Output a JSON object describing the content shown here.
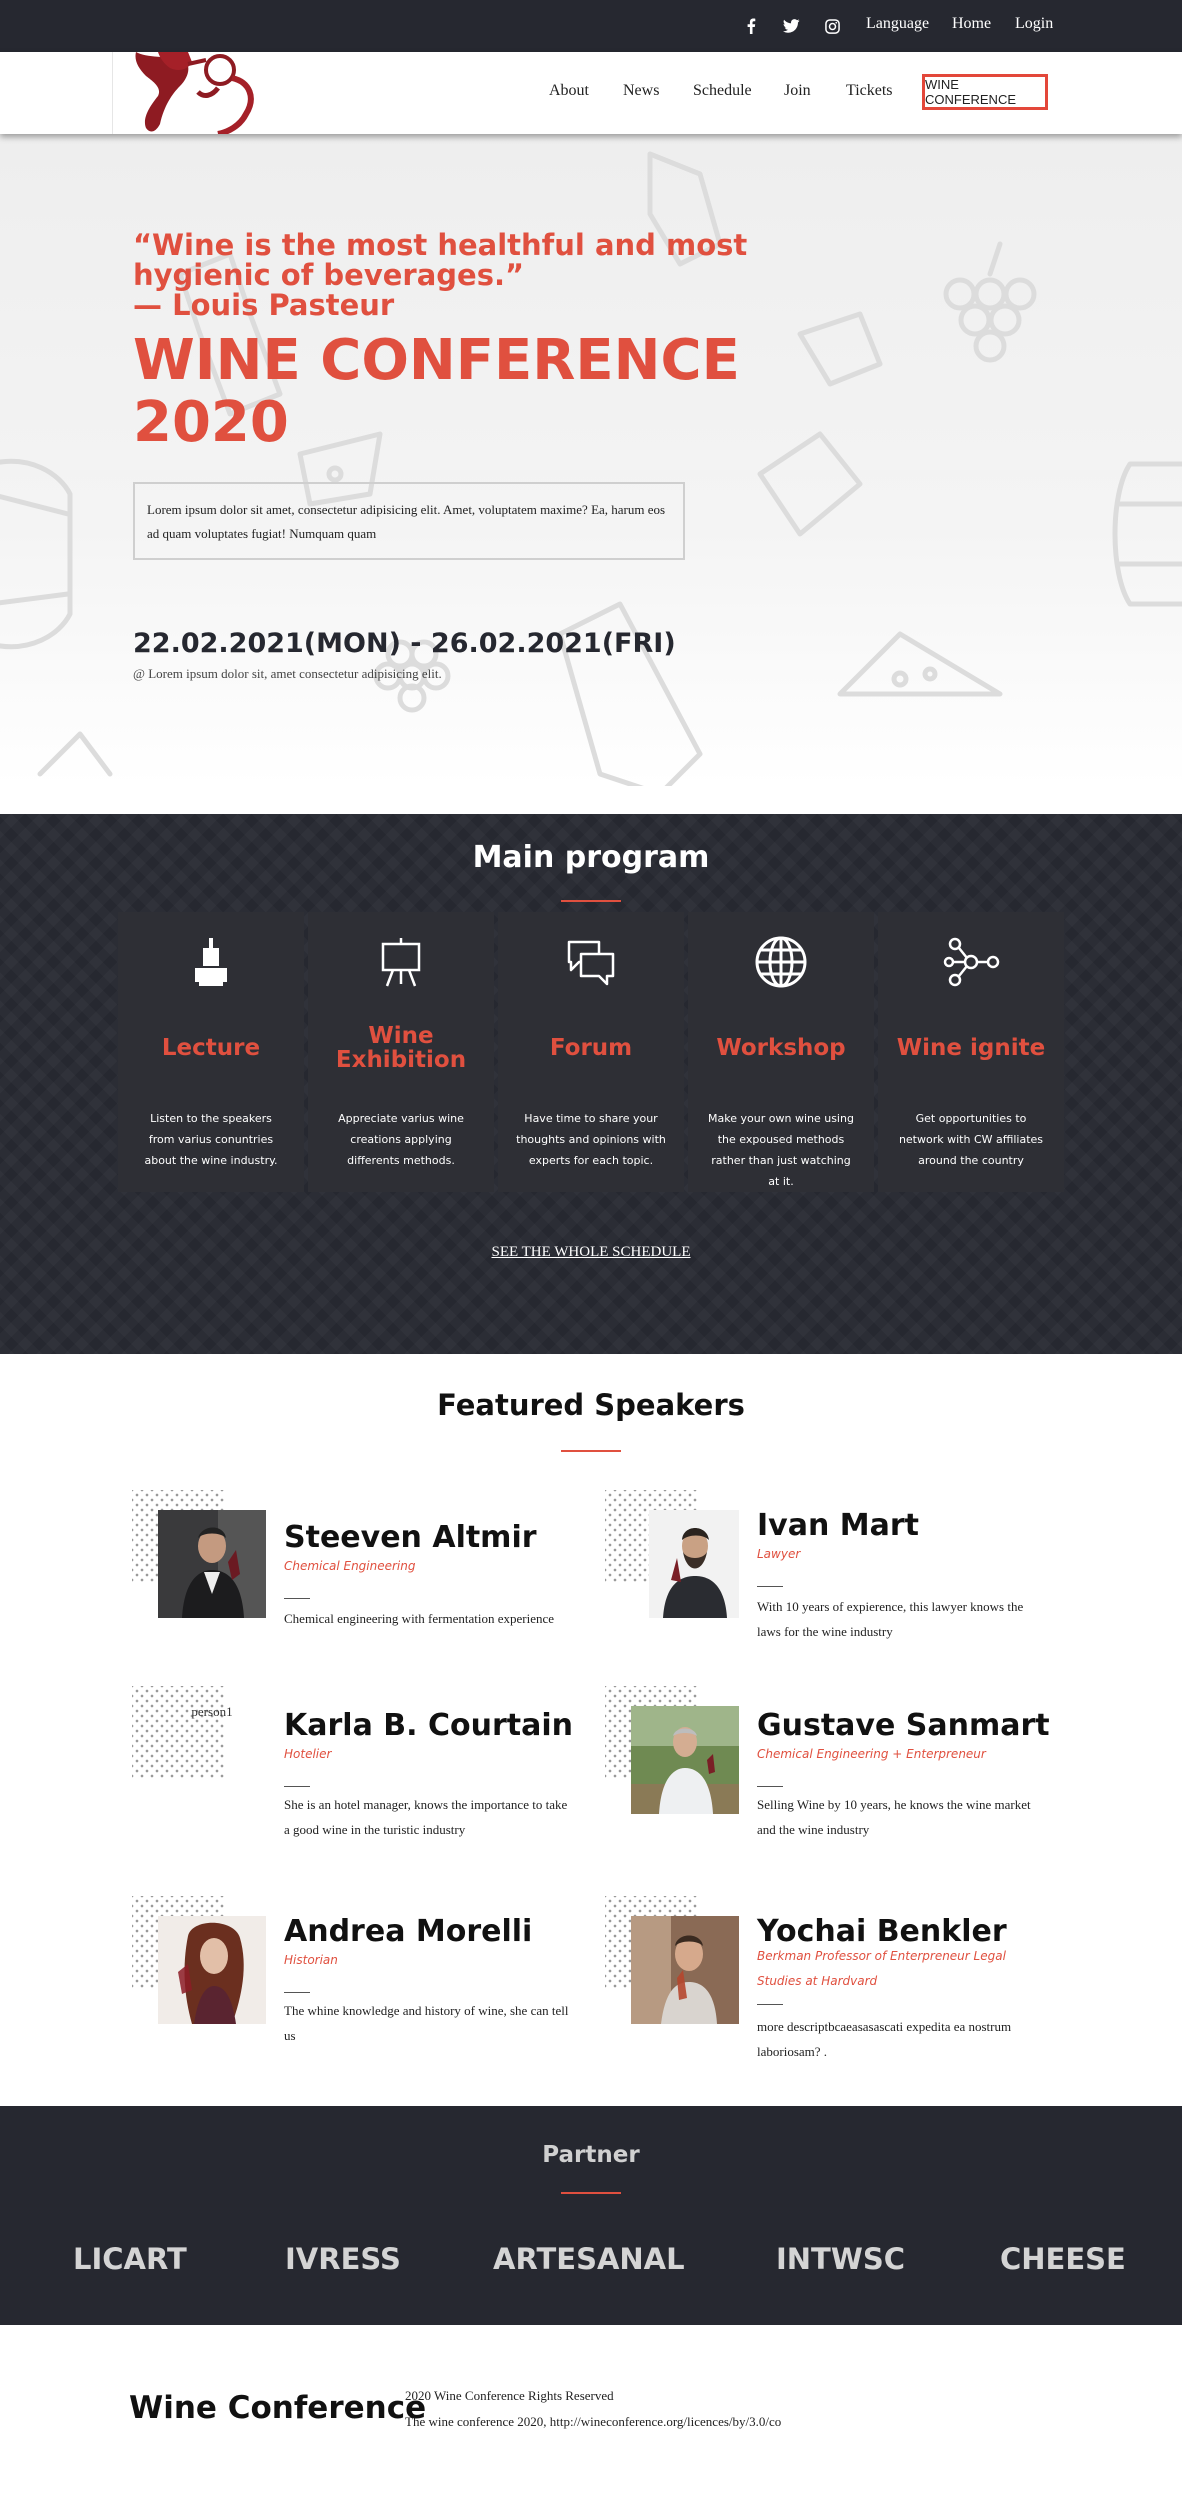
{
  "topbar": {
    "social": [
      "facebook-icon",
      "twitter-icon",
      "instagram-icon"
    ],
    "links": [
      "Language",
      "Home",
      "Login"
    ]
  },
  "nav": {
    "items": [
      "About",
      "News",
      "Schedule",
      "Join",
      "Tickets"
    ],
    "cta": "WINE CONFERENCE"
  },
  "hero": {
    "quote": "“Wine is the most healthful and most hygienic of beverages.”",
    "author": "— Louis Pasteur",
    "title": "WINE CONFERENCE 2020",
    "box_text": "Lorem ipsum dolor sit amet, consectetur adipisicing elit. Amet, voluptatem maxime? Ea, harum eos ad quam voluptates fugiat! Numquam quam",
    "date": "22.02.2021(MON) - 26.02.2021(FRI)",
    "location": "@ Lorem ipsum dolor sit, amet consectetur adipisicing elit."
  },
  "program": {
    "title": "Main program",
    "cards": [
      {
        "icon": "lectern-icon",
        "title": "Lecture",
        "desc": "Listen to the speakers from varius conuntries about the wine industry."
      },
      {
        "icon": "easel-board-icon",
        "title": "Wine Exhibition",
        "desc": "Appreciate varius wine creations applying differents methods."
      },
      {
        "icon": "chat-bubbles-icon",
        "title": "Forum",
        "desc": "Have time to share your thoughts and opinions with experts for each topic."
      },
      {
        "icon": "globe-icon",
        "title": "Workshop",
        "desc": "Make your own wine using the expoused methods rather than just watching at it."
      },
      {
        "icon": "network-icon",
        "title": "Wine ignite",
        "desc": "Get opportunities to network with CW affiliates around the country"
      }
    ],
    "schedule_link": "SEE THE WHOLE SCHEDULE"
  },
  "speakers": {
    "title": "Featured Speakers",
    "items": [
      {
        "name": "Steeven Altmir",
        "role": "Chemical Engineering",
        "desc": "Chemical engineering with fermentation experience"
      },
      {
        "name": "Ivan Mart",
        "role": "Lawyer",
        "desc": "With 10 years of expierence, this lawyer knows the laws for the wine industry"
      },
      {
        "name": "Karla B. Courtain",
        "role": "Hotelier",
        "desc": "She is an hotel manager, knows the importance to take a good wine in the turistic industry",
        "photo_alt": "person1"
      },
      {
        "name": "Gustave Sanmart",
        "role": "Chemical Engineering + Enterpreneur",
        "desc": "Selling Wine by 10 years, he knows the wine market and the wine industry"
      },
      {
        "name": "Andrea Morelli",
        "role": "Historian",
        "desc": "The whine knowledge and history of wine, she can tell us"
      },
      {
        "name": "Yochai Benkler",
        "role": "Berkman Professor of Enterpreneur Legal Studies at Hardvard",
        "desc": "more descriptbcaeasasascati expedita ea nostrum laboriosam? ."
      }
    ]
  },
  "partner": {
    "title": "Partner",
    "logos": [
      "LICART",
      "IVRESS",
      "ARTESANAL",
      "INTWSC",
      "CHEESE"
    ]
  },
  "footer": {
    "brand": "Wine Conference",
    "rights": "2020 Wine Conference Rights Reserved",
    "license": "The wine conference 2020, http://wineconference.org/licences/by/3.0/co"
  },
  "colors": {
    "accent": "#e0503f",
    "dark": "#262830"
  }
}
